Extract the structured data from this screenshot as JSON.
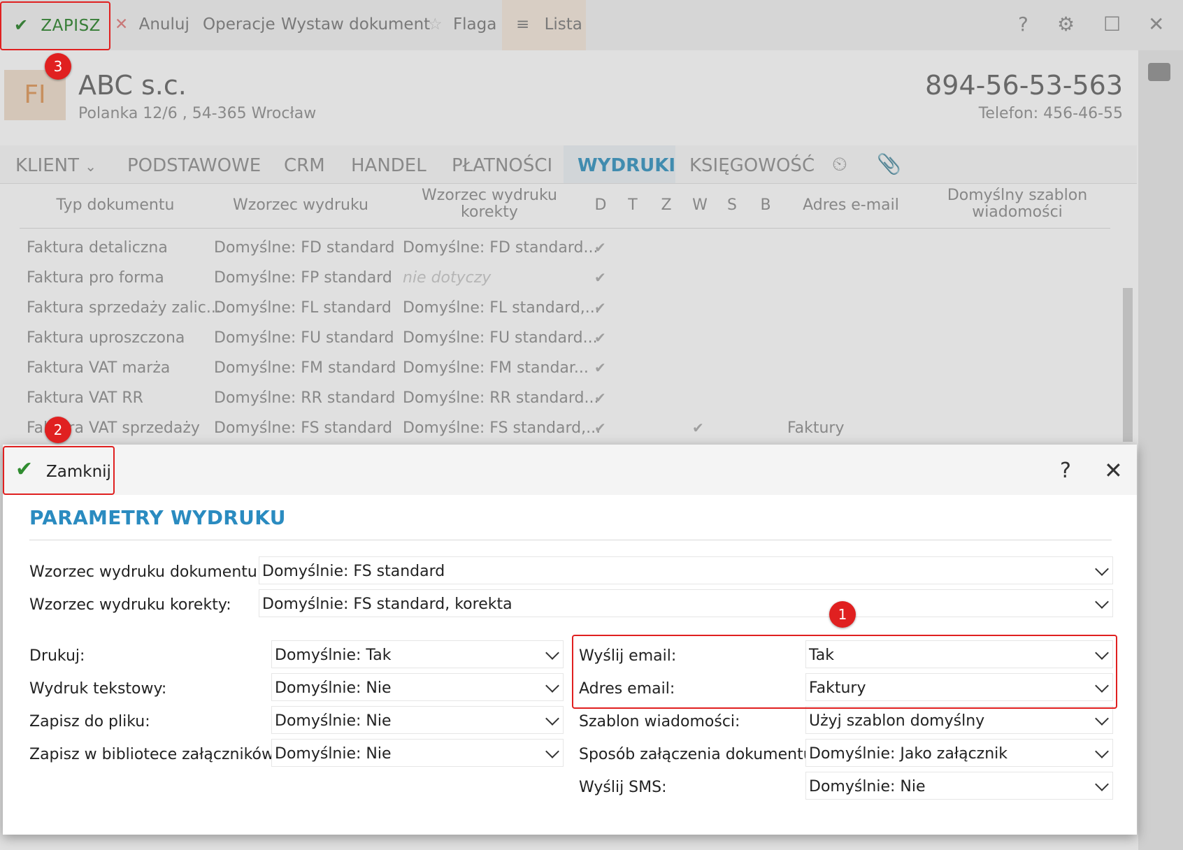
{
  "toolbar": {
    "save": "ZAPISZ",
    "cancel": "Anuluj",
    "operations": "Operacje",
    "issue_document": "Wystaw dokument",
    "flag": "Flaga",
    "list": "Lista"
  },
  "client": {
    "logo_text": "FI",
    "name": "ABC s.c.",
    "address": "Polanka  12/6 , 54-365 Wrocław",
    "nip": "894-56-53-563",
    "phone": "Telefon: 456-46-55"
  },
  "tabs": [
    "KLIENT",
    "PODSTAWOWE",
    "CRM",
    "HANDEL",
    "PŁATNOŚCI",
    "WYDRUKI",
    "KSIĘGOWOŚĆ"
  ],
  "grid": {
    "headers": {
      "type": "Typ dokumentu",
      "pattern": "Wzorzec wydruku",
      "correction_1": "Wzorzec wydruku",
      "correction_2": "korekty",
      "d": "D",
      "t": "T",
      "z": "Z",
      "w": "W",
      "s": "S",
      "b": "B",
      "email": "Adres e-mail",
      "template_1": "Domyślny szablon",
      "template_2": "wiadomości"
    },
    "rows": [
      {
        "type": "Faktura detaliczna",
        "pattern": "Domyślne: FD standard",
        "correction": "Domyślne: FD standard..."
      },
      {
        "type": "Faktura pro forma",
        "pattern": "Domyślne: FP standard",
        "correction": "nie dotyczy"
      },
      {
        "type": "Faktura sprzedaży zalic...",
        "pattern": "Domyślne: FL standard",
        "correction": "Domyślne: FL standard,..."
      },
      {
        "type": "Faktura uproszczona",
        "pattern": "Domyślne: FU standard",
        "correction": "Domyślne: FU standard..."
      },
      {
        "type": "Faktura VAT marża",
        "pattern": "Domyślne: FM standard",
        "correction": "Domyślne: FM standar..."
      },
      {
        "type": "Faktura VAT RR",
        "pattern": "Domyślne: RR standard",
        "correction": "Domyślne: RR standard..."
      },
      {
        "type": "Faktura VAT sprzedaży",
        "pattern": "Domyślne: FS standard",
        "correction": "Domyślne: FS standard,...",
        "email": "Faktury"
      }
    ]
  },
  "dialog": {
    "close_button": "Zamknij",
    "help": "?",
    "title": "PARAMETRY WYDRUKU",
    "doc_pattern_label": "Wzorzec wydruku dokumentu:",
    "doc_pattern_value": "Domyślnie:  FS standard",
    "corr_pattern_label": "Wzorzec wydruku korekty:",
    "corr_pattern_value": "Domyślnie:  FS standard, korekta",
    "left": [
      {
        "label": "Drukuj:",
        "value": "Domyślnie:  Tak"
      },
      {
        "label": "Wydruk tekstowy:",
        "value": "Domyślnie:  Nie"
      },
      {
        "label": "Zapisz do pliku:",
        "value": "Domyślnie:  Nie"
      },
      {
        "label": "Zapisz w bibliotece załączników:",
        "value": "Domyślnie:  Nie"
      }
    ],
    "right": [
      {
        "label": "Wyślij email:",
        "value": "Tak"
      },
      {
        "label": "Adres email:",
        "value": "Faktury"
      },
      {
        "label": "Szablon wiadomości:",
        "value": "Użyj szablon domyślny"
      },
      {
        "label": "Sposób załączenia dokumentu:",
        "value": "Domyślnie: Jako załącznik"
      },
      {
        "label": "Wyślij SMS:",
        "value": "Domyślnie:  Nie"
      }
    ]
  },
  "annotations": {
    "badge1": "1",
    "badge2": "2",
    "badge3": "3"
  },
  "colors": {
    "accent_blue": "#2a8bc0",
    "annotation_red": "#e02020",
    "check_green": "#2f8c2f"
  }
}
